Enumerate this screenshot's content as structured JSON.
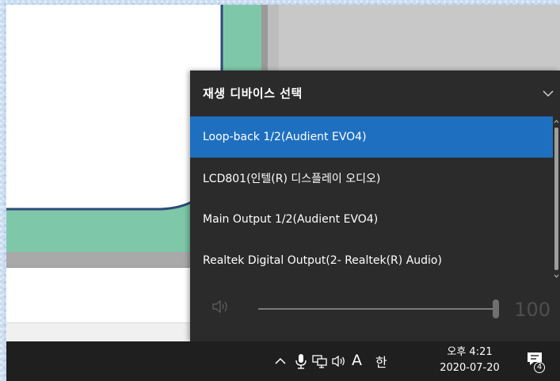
{
  "flyout": {
    "title": "재생 디바이스 선택",
    "devices": [
      {
        "label": "Loop-back 1/2(Audient EVO4)",
        "selected": true
      },
      {
        "label": "LCD801(인텔(R) 디스플레이 오디오)",
        "selected": false
      },
      {
        "label": "Main Output 1/2(Audient EVO4)",
        "selected": false
      },
      {
        "label": "Realtek Digital Output(2- Realtek(R) Audio)",
        "selected": false
      }
    ],
    "volume": {
      "value": "100",
      "level": 1.0
    }
  },
  "taskbar": {
    "input_mode": "A",
    "ime": "한",
    "clock_time": "오후 4:21",
    "clock_date": "2020-07-20",
    "notification_count": "4"
  },
  "colors": {
    "flyout_bg": "#2b2b2b",
    "selected_bg": "#1e6fc0",
    "taskbar_bg": "#1f1f1f",
    "canvas_green": "#7ec8a9",
    "canvas_border": "#2d4a78"
  },
  "icons": [
    "chevron-down-icon",
    "speaker-icon",
    "chevron-up-icon",
    "microphone-icon",
    "network-icon",
    "notification-icon"
  ]
}
